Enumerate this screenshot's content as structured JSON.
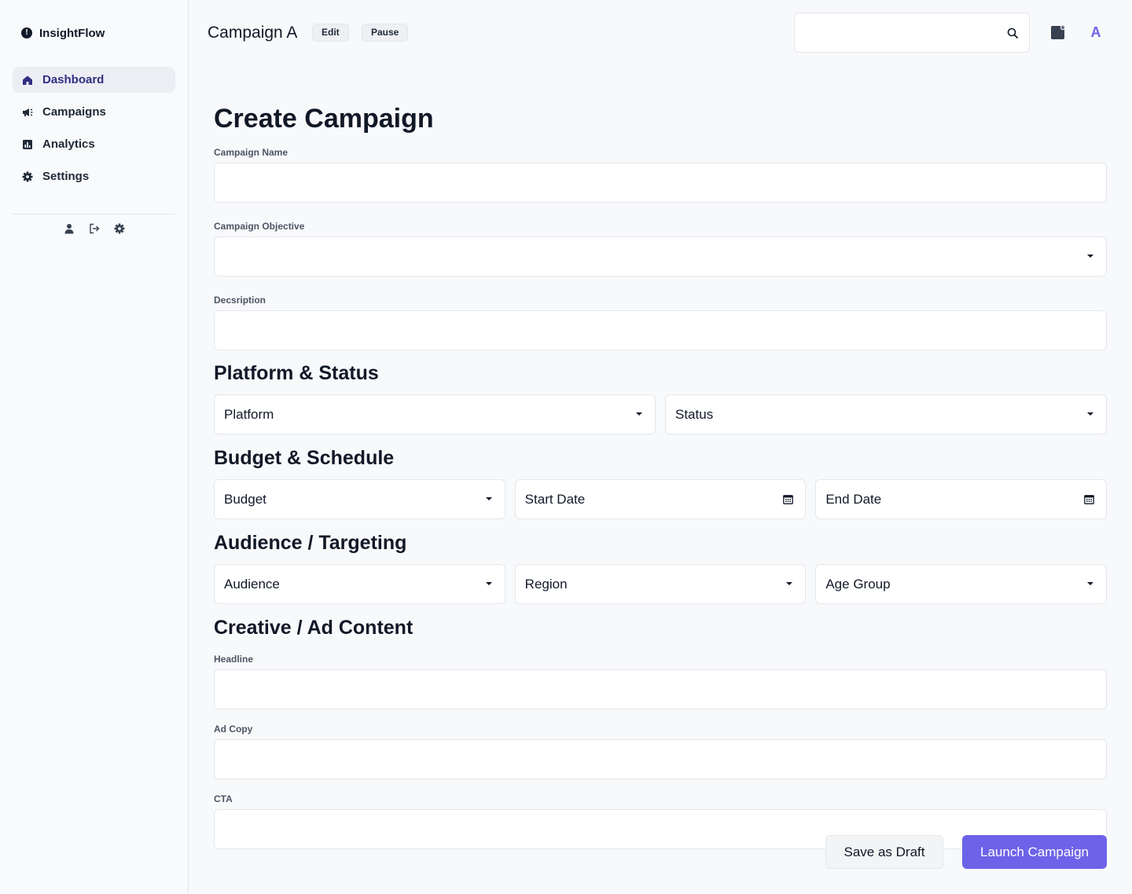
{
  "app": {
    "name": "InsightFlow",
    "accent_color": "#6c63e8"
  },
  "sidebar": {
    "items": [
      {
        "label": "Dashboard",
        "icon": "home-icon",
        "active": true
      },
      {
        "label": "Campaigns",
        "icon": "megaphone-icon",
        "active": false
      },
      {
        "label": "Analytics",
        "icon": "chart-icon",
        "active": false
      },
      {
        "label": "Settings",
        "icon": "gear-icon",
        "active": false
      }
    ],
    "actions": [
      "user-icon",
      "logout-icon",
      "gear-icon"
    ]
  },
  "header": {
    "title": "Campaign A",
    "edit_label": "Edit",
    "pause_label": "Pause",
    "search": {
      "value": "",
      "placeholder": ""
    },
    "avatar_initial": "A"
  },
  "form": {
    "title": "Create Campaign",
    "campaign_name": {
      "label": "Campaign Name",
      "value": ""
    },
    "campaign_objective": {
      "label": "Campaign Objective",
      "value": ""
    },
    "description": {
      "label": "Decsription",
      "value": ""
    },
    "platform_status": {
      "title": "Platform & Status",
      "platform": "Platform",
      "status": "Status"
    },
    "budget_schedule": {
      "title": "Budget & Schedule",
      "budget": "Budget",
      "start_date": "Start Date",
      "end_date": "End Date"
    },
    "audience": {
      "title": "Audience / Targeting",
      "audience": "Audience",
      "region": "Region",
      "age_group": "Age Group"
    },
    "creative": {
      "title": "Creative / Ad Content",
      "headline": {
        "label": "Headline",
        "value": ""
      },
      "ad_copy": {
        "label": "Ad Copy",
        "value": ""
      },
      "cta": {
        "label": "CTA",
        "value": ""
      }
    },
    "save_draft_label": "Save as Draft",
    "launch_label": "Launch Campaign"
  }
}
